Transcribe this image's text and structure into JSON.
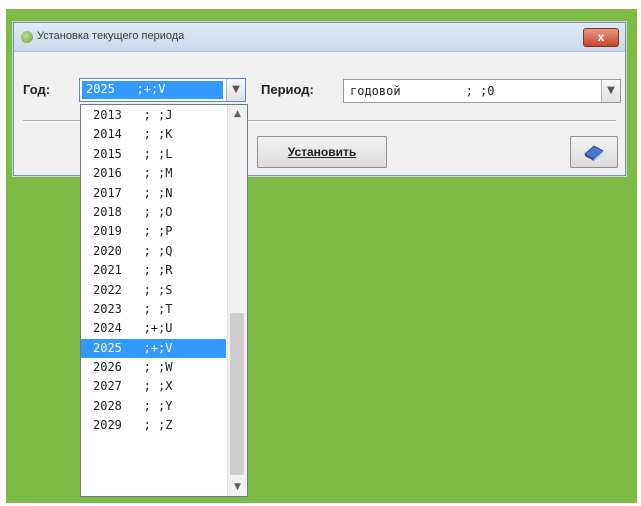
{
  "window": {
    "title": "Установка текущего периода",
    "close_label": "x"
  },
  "form": {
    "year_label": "Год:",
    "year_value": "2025   ;+;V",
    "period_label": "Период:",
    "period_value": "годовой         ; ;0"
  },
  "buttons": {
    "set_label": "Установить",
    "clear_icon": "eraser-icon"
  },
  "dropdown": {
    "items": [
      "2013   ; ;J",
      "2014   ; ;K",
      "2015   ; ;L",
      "2016   ; ;M",
      "2017   ; ;N",
      "2018   ; ;O",
      "2019   ; ;P",
      "2020   ; ;Q",
      "2021   ; ;R",
      "2022   ; ;S",
      "2023   ; ;T",
      "2024   ;+;U",
      "2025   ;+;V",
      "2026   ; ;W",
      "2027   ; ;X",
      "2028   ; ;Y",
      "2029   ; ;Z"
    ],
    "selected_index": 12
  },
  "colors": {
    "desktop": "#7dbb47",
    "selection": "#3399ff"
  }
}
